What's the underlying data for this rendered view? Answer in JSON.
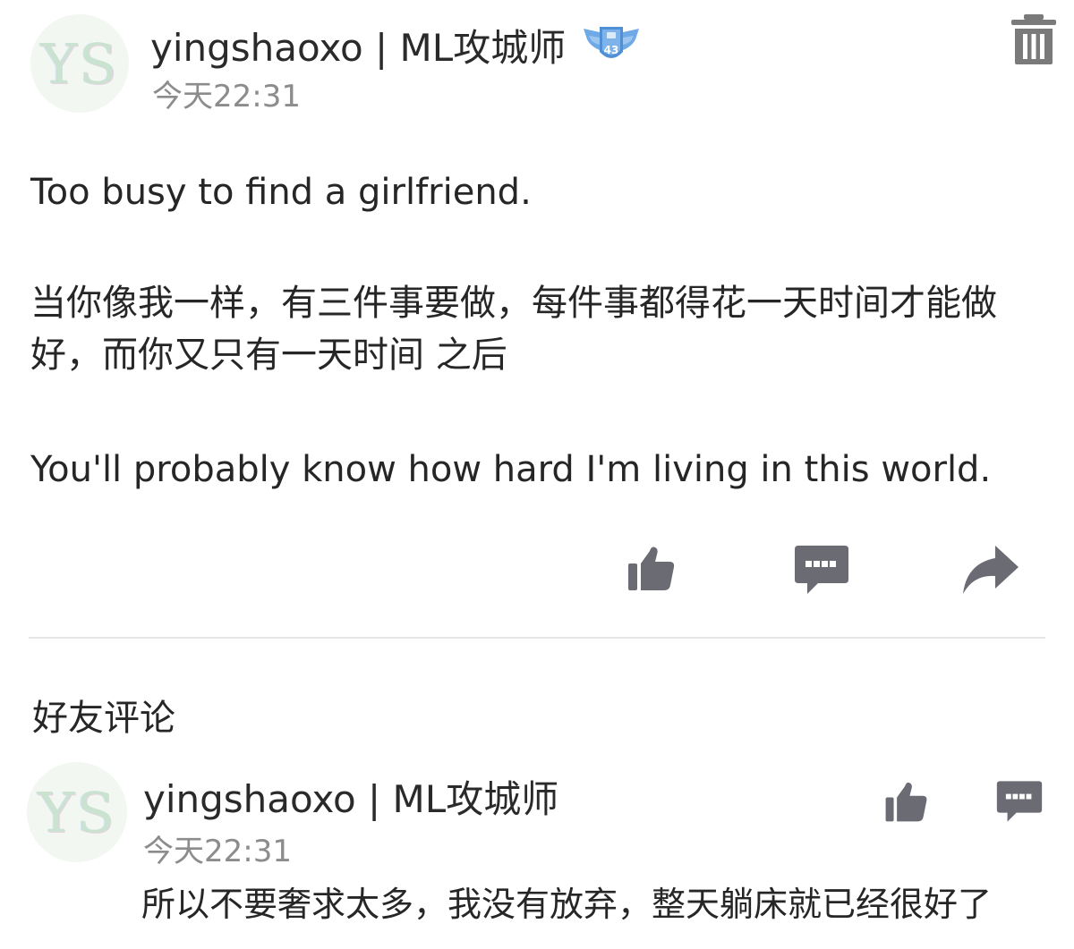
{
  "post": {
    "avatar_text": "YS",
    "username": "yingshaoxo | ML攻城师",
    "badge_number": "43",
    "time": "今天22:31",
    "paragraphs": [
      "Too busy to find a girlfriend.",
      "当你像我一样，有三件事要做，每件事都得花一天时间才能做好，而你又只有一天时间 之后",
      "You'll probably know how hard I'm living in this world."
    ]
  },
  "comments_section": {
    "title": "好友评论",
    "items": [
      {
        "avatar_text": "YS",
        "username": "yingshaoxo | ML攻城师",
        "time": "今天22:31",
        "text": "所以不要奢求太多，我没有放弃，整天躺床就已经很好了"
      }
    ]
  },
  "icons": {
    "trash": "trash-icon",
    "like": "thumbs-up-icon",
    "comment": "comment-bubble-icon",
    "share": "share-arrow-icon"
  },
  "colors": {
    "icon_gray": "#6b6b73",
    "badge_blue": "#4f8fd6",
    "time_gray": "#8c8c8c"
  }
}
